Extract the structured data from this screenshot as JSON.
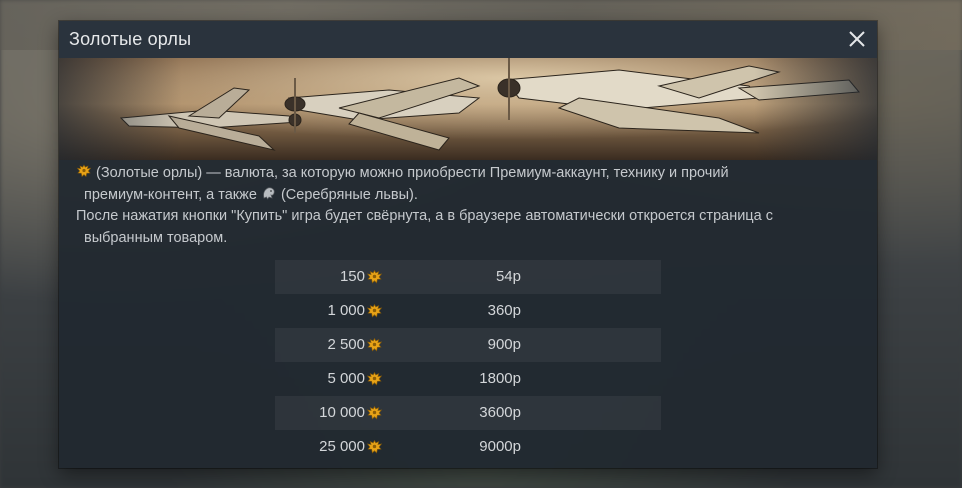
{
  "dialog": {
    "title": "Золотые орлы"
  },
  "description": {
    "line1": "(Золотые орлы) — валюта, за которую можно приобрести Премиум-аккаунт, технику и прочий",
    "line2a": "премиум-контент, а также",
    "line2b": "(Серебряные львы).",
    "line3": "После нажатия кнопки \"Купить\" игра будет свёрнута, а в браузере автоматически откроется страница с",
    "line4": "выбранным товаром."
  },
  "icons": {
    "gold_eagle": "gold-eagle-icon",
    "silver_lion": "silver-lion-icon",
    "close": "close-icon"
  },
  "colors": {
    "gold": "#e8a317",
    "silver": "#b8bcc0",
    "dialog_bg": "#212830",
    "titlebar_bg": "#2a333d"
  },
  "prices": [
    {
      "amount": "150",
      "price": "54р"
    },
    {
      "amount": "1 000",
      "price": "360р"
    },
    {
      "amount": "2 500",
      "price": "900р"
    },
    {
      "amount": "5 000",
      "price": "1800р"
    },
    {
      "amount": "10 000",
      "price": "3600р"
    },
    {
      "amount": "25 000",
      "price": "9000р"
    }
  ]
}
